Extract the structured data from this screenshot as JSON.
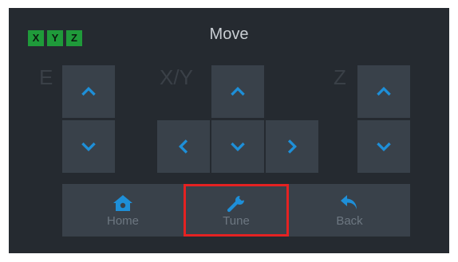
{
  "header": {
    "title": "Move",
    "axis_badges": [
      "X",
      "Y",
      "Z"
    ]
  },
  "axis_labels": {
    "e": "E",
    "xy": "X/Y",
    "z": "Z"
  },
  "icons": {
    "up": "chevron-up-icon",
    "down": "chevron-down-icon",
    "left": "chevron-left-icon",
    "right": "chevron-right-icon",
    "home": "home-icon",
    "tune": "wrench-icon",
    "back": "back-arrow-icon"
  },
  "bottom_bar": {
    "home_label": "Home",
    "tune_label": "Tune",
    "back_label": "Back"
  },
  "colors": {
    "background": "#252a30",
    "button": "#39414a",
    "accent": "#1e8fd8",
    "badge": "#1f9a3a",
    "highlight": "#e42222"
  }
}
